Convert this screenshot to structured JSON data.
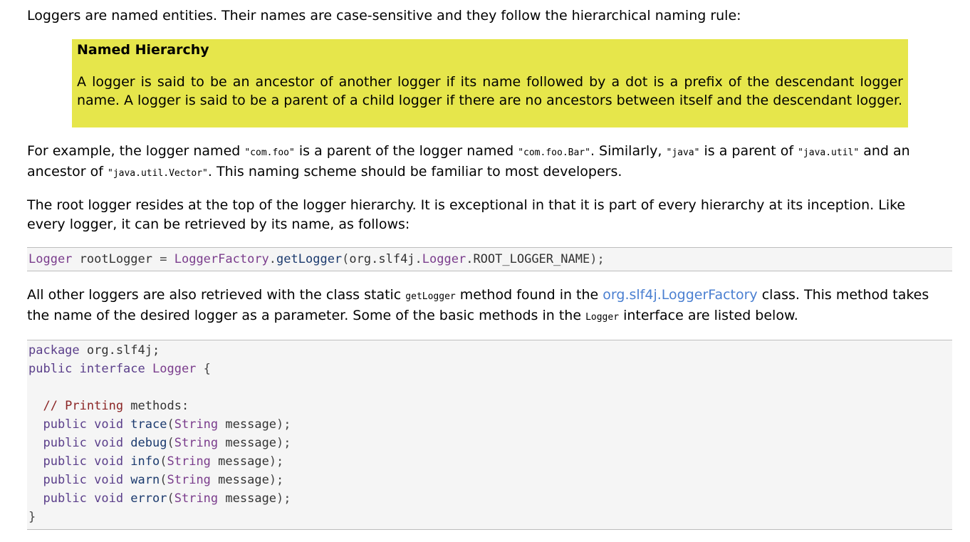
{
  "intro": "Loggers are named entities. Their names are case-sensitive and they follow the hierarchical naming rule:",
  "callout": {
    "title": "Named Hierarchy",
    "body": "A logger is said to be an ancestor of another logger if its name followed by a dot is a prefix of the descendant logger name. A logger is said to be a parent of a child logger if there are no ancestors between itself and the descendant logger."
  },
  "example": {
    "t1": "For example, the logger named ",
    "c1": "\"com.foo\"",
    "t2": " is a parent of the logger named ",
    "c2": "\"com.foo.Bar\"",
    "t3": ". Similarly, ",
    "c3": "\"java\"",
    "t4": " is a parent of ",
    "c4": "\"java.util\"",
    "t5": " and an ancestor of ",
    "c5": "\"java.util.Vector\"",
    "t6": ". This naming scheme should be familiar to most developers."
  },
  "root_para": "The root logger resides at the top of the logger hierarchy. It is exceptional in that it is part of every hierarchy at its inception. Like every logger, it can be retrieved by its name, as follows:",
  "root_code": {
    "type": "Logger",
    "var": " rootLogger ",
    "eq": "=",
    "factory": " LoggerFactory",
    "dot1": ".",
    "method": "getLogger",
    "args_open": "(",
    "pkg": "org.slf4j.",
    "cls": "Logger",
    "const": ".ROOT_LOGGER_NAME",
    "close": ");"
  },
  "other_para": {
    "t1": "All other loggers are also retrieved with the class static ",
    "c1": "getLogger",
    "t2": " method found in the ",
    "link": "org.slf4j.LoggerFactory",
    "t3": " class. This method takes the name of the desired logger as a parameter. Some of the basic methods in the ",
    "c2": "Logger",
    "t4": " interface are listed below."
  },
  "interface_code": {
    "line1_kw": "package",
    "line1_rest": " org.slf4j;",
    "line2_kw": "public interface",
    "line2_name": " Logger",
    "line2_brace": " {",
    "comment": "  // Printing ",
    "comment2": "methods:",
    "methods": [
      {
        "kw": "  public void",
        "name": " trace",
        "open": "(",
        "type": "String",
        "param": " message",
        "close": ");"
      },
      {
        "kw": "  public void",
        "name": " debug",
        "open": "(",
        "type": "String",
        "param": " message",
        "close": ");"
      },
      {
        "kw": "  public void",
        "name": " info",
        "open": "(",
        "type": "String",
        "param": " message",
        "close": ");"
      },
      {
        "kw": "  public void",
        "name": " warn",
        "open": "(",
        "type": "String",
        "param": " message",
        "close": ");"
      },
      {
        "kw": "  public void",
        "name": " error",
        "open": "(",
        "type": "String",
        "param": " message",
        "close": ");"
      }
    ],
    "end_brace": "}"
  }
}
